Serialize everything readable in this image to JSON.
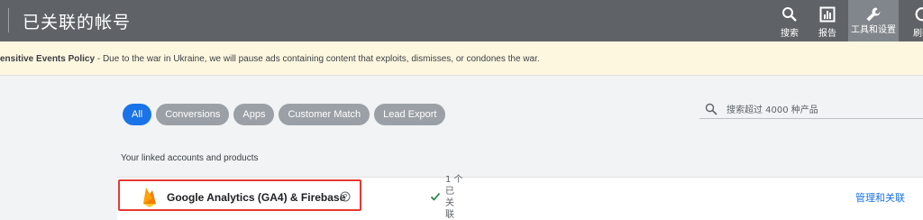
{
  "header": {
    "title": "已关联的帐号",
    "tools": [
      {
        "name": "search-icon",
        "label": "搜索"
      },
      {
        "name": "report-icon",
        "label": "报告"
      },
      {
        "name": "wrench-icon",
        "label": "工具和设置"
      },
      {
        "name": "refresh-icon",
        "label": "刷新"
      }
    ]
  },
  "banner": {
    "bold_text": "ensitive Events Policy",
    "text": " - Due to the war in Ukraine, we will pause ads containing content that exploits, dismisses, or condones the war."
  },
  "filters": [
    "All",
    "Conversions",
    "Apps",
    "Customer Match",
    "Lead Export"
  ],
  "search": {
    "placeholder": "搜索超过 4000 种产品"
  },
  "section_label": "Your linked accounts and products",
  "accounts": [
    {
      "icon": "firebase-icon",
      "name": "Google Analytics (GA4) & Firebase",
      "status": "1 个 已 关 联",
      "action": "管理和关联"
    }
  ],
  "colors": {
    "accent": "#1a73e8",
    "header_bg": "#5f6368",
    "banner_bg": "#fef7e0",
    "highlight": "#e53935"
  }
}
